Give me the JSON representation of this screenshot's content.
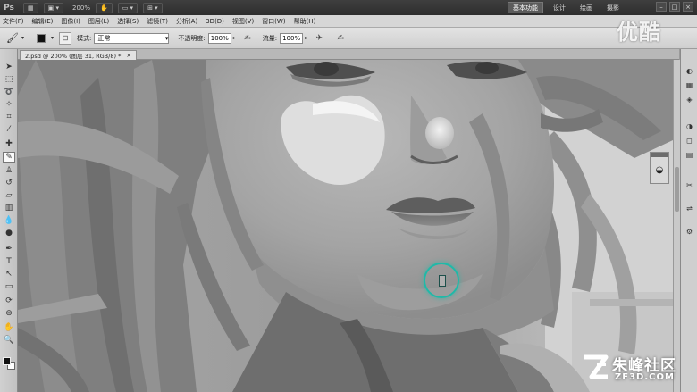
{
  "app": {
    "logo": "Ps",
    "zoom_display": "200%",
    "workspaces": [
      {
        "label": "基本功能",
        "active": true
      },
      {
        "label": "设计",
        "active": false
      },
      {
        "label": "绘画",
        "active": false
      },
      {
        "label": "摄影",
        "active": false
      }
    ]
  },
  "menu": [
    "文件(F)",
    "编辑(E)",
    "图像(I)",
    "图层(L)",
    "选择(S)",
    "滤镜(T)",
    "分析(A)",
    "3D(D)",
    "视图(V)",
    "窗口(W)",
    "帮助(H)"
  ],
  "options": {
    "mode_label": "模式:",
    "mode_value": "正常",
    "opacity_label": "不透明度:",
    "opacity_value": "100%",
    "flow_label": "流量:",
    "flow_value": "100%"
  },
  "document": {
    "tab_title": "2.psd @ 200% (图层 31, RGB/8) *",
    "close_glyph": "×"
  },
  "watermarks": {
    "youku": "优酷",
    "site_name": "朱峰社区",
    "site_url": "ZF3D.COM"
  },
  "colors": {
    "brush_cursor": "#1fb9a8",
    "foreground": "#111111",
    "background": "#ffffff"
  }
}
